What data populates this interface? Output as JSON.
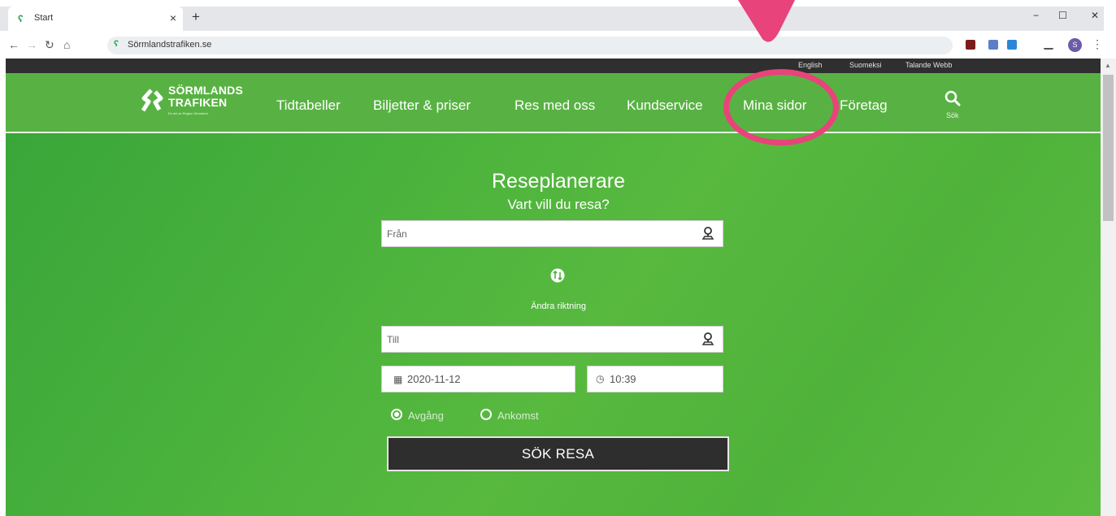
{
  "browser": {
    "tab_title": "Start",
    "tab_close": "×",
    "new_tab": "+",
    "url": "Sörmlandstrafiken.se",
    "window_controls": {
      "minimize": "−",
      "maximize": "☐",
      "close": "✕"
    }
  },
  "site": {
    "top_links": [
      "English",
      "Suomeksi",
      "Talande Webb"
    ],
    "logo": {
      "line1": "SÖRMLANDS",
      "line2": "TRAFIKEN",
      "tagline": "En del av Region Sörmland"
    },
    "nav": [
      "Tidtabeller",
      "Biljetter & priser",
      "Res med oss",
      "Kundservice",
      "Mina sidor",
      "Företag"
    ],
    "search_label": "Sök",
    "highlight_color": "#e8437a",
    "brand_green": "#58b243"
  },
  "planner": {
    "title": "Reseplanerare",
    "subtitle": "Vart vill du resa?",
    "from_placeholder": "Från",
    "to_placeholder": "Till",
    "swap_label": "Ändra riktning",
    "date": "2020-11-12",
    "time": "10:39",
    "departure_label": "Avgång",
    "arrival_label": "Ankomst",
    "selected_mode": "Avgång",
    "search_button": "SÖK RESA"
  }
}
